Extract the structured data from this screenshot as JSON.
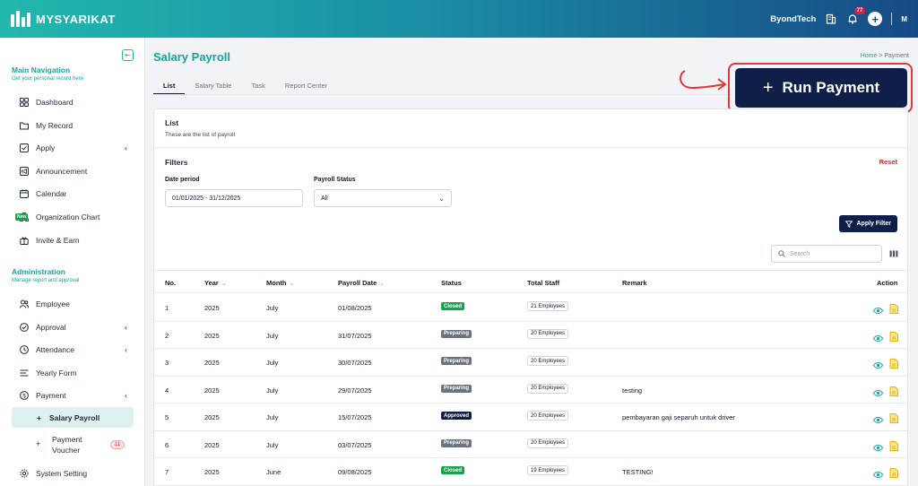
{
  "app": {
    "name": "MYSYARIKAT"
  },
  "topbar": {
    "company": "ByondTech",
    "notifications": "77",
    "avatar": "M"
  },
  "sidebar": {
    "main_title": "Main Navigation",
    "main_sub": "Get your personal record here",
    "main_items": [
      {
        "label": "Dashboard",
        "icon": "dashboard-icon"
      },
      {
        "label": "My Record",
        "icon": "folder-icon"
      },
      {
        "label": "Apply",
        "icon": "checkbox-icon",
        "chevron": true
      },
      {
        "label": "Announcement",
        "icon": "announcement-icon"
      },
      {
        "label": "Calendar",
        "icon": "calendar-icon"
      },
      {
        "label": "Organization Chart",
        "icon": "org-chart-icon",
        "badge": "New"
      },
      {
        "label": "Invite & Earn",
        "icon": "gift-icon"
      }
    ],
    "admin_title": "Administration",
    "admin_sub": "Manage report and approval",
    "admin_items": [
      {
        "label": "Employee",
        "icon": "users-icon"
      },
      {
        "label": "Approval",
        "icon": "approval-icon",
        "chevron": true
      },
      {
        "label": "Attendance",
        "icon": "clock-icon",
        "chevron": true
      },
      {
        "label": "Yearly Form",
        "icon": "form-icon"
      },
      {
        "label": "Payment",
        "icon": "payment-icon",
        "chevron": true
      }
    ],
    "payment_sub": {
      "active": "Salary Payroll",
      "voucher_line1": "Payment",
      "voucher_line2": "Voucher",
      "voucher_count": "11"
    },
    "system_setting": "System Setting"
  },
  "page": {
    "title": "Salary Payroll",
    "breadcrumb": {
      "home": "Home",
      "sep": ">",
      "current": "Payment"
    },
    "tabs": [
      "List",
      "Salary Table",
      "Task",
      "Report Center"
    ],
    "run_payment": "Run Payment"
  },
  "card": {
    "title": "List",
    "subtitle": "These are the list of payroll",
    "filters_title": "Filters",
    "reset": "Reset",
    "date_label": "Date period",
    "date_value": "01/01/2025 - 31/12/2025",
    "status_label": "Payroll Status",
    "status_value": "All",
    "apply_filter": "Apply Filter",
    "search_placeholder": "Search"
  },
  "table": {
    "headers": [
      "No.",
      "Year",
      "Month",
      "Payroll Date",
      "Status",
      "Total Staff",
      "Remark",
      "Action"
    ],
    "rows": [
      {
        "no": "1",
        "year": "2025",
        "month": "July",
        "date": "01/08/2025",
        "status": "Closed",
        "staff": "21 Employees",
        "remark": ""
      },
      {
        "no": "2",
        "year": "2025",
        "month": "July",
        "date": "31/07/2025",
        "status": "Preparing",
        "staff": "20 Employees",
        "remark": ""
      },
      {
        "no": "3",
        "year": "2025",
        "month": "July",
        "date": "30/07/2025",
        "status": "Preparing",
        "staff": "20 Employees",
        "remark": ""
      },
      {
        "no": "4",
        "year": "2025",
        "month": "July",
        "date": "29/07/2025",
        "status": "Preparing",
        "staff": "20 Employees",
        "remark": "testing"
      },
      {
        "no": "5",
        "year": "2025",
        "month": "July",
        "date": "15/07/2025",
        "status": "Approved",
        "staff": "20 Employees",
        "remark": "pembayaran gaji separuh untuk driver"
      },
      {
        "no": "6",
        "year": "2025",
        "month": "July",
        "date": "03/07/2025",
        "status": "Preparing",
        "staff": "20 Employees",
        "remark": ""
      },
      {
        "no": "7",
        "year": "2025",
        "month": "June",
        "date": "09/08/2025",
        "status": "Closed",
        "staff": "19 Employees",
        "remark": "TESTING!"
      }
    ]
  },
  "colors": {
    "accent": "#14a59b",
    "navy": "#0f1f4a",
    "closed": "#16a34a",
    "preparing": "#6b7280",
    "approved": "#0f1f4a",
    "highlight": "#e5383b"
  }
}
